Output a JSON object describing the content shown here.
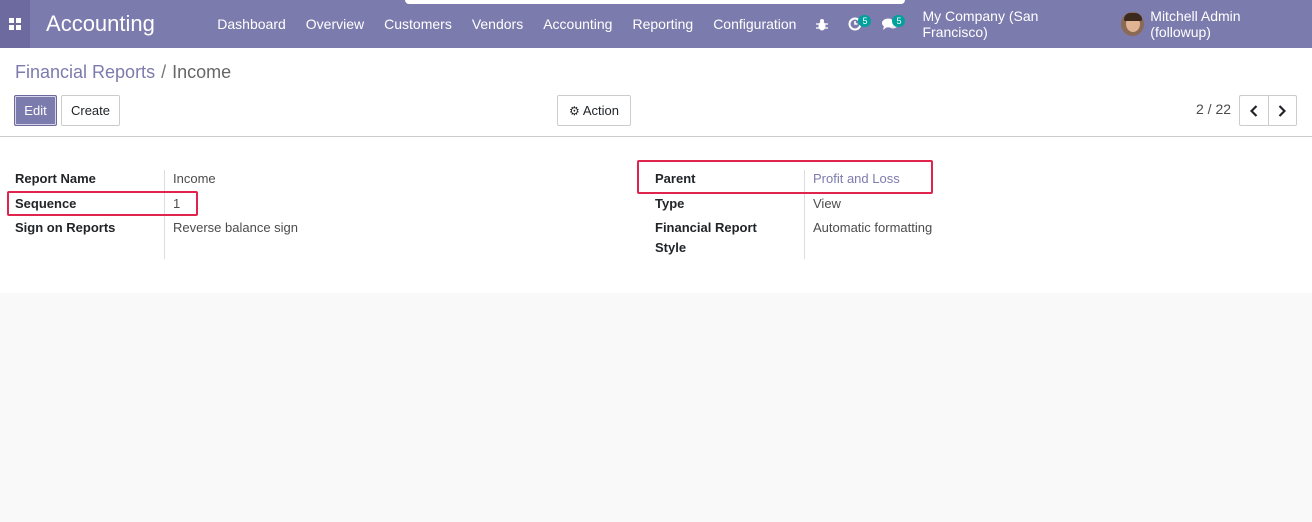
{
  "navbar": {
    "app_title": "Accounting",
    "menu": [
      "Dashboard",
      "Overview",
      "Customers",
      "Vendors",
      "Accounting",
      "Reporting",
      "Configuration"
    ],
    "activity_badge": "5",
    "messages_badge": "5",
    "company": "My Company (San Francisco)",
    "user": "Mitchell Admin (followup)",
    "brand_color": "#7c7bad"
  },
  "breadcrumb": {
    "parent": "Financial Reports",
    "separator": "/",
    "current": "Income"
  },
  "toolbar": {
    "edit_label": "Edit",
    "create_label": "Create",
    "action_label": "Action"
  },
  "pager": {
    "value": "2 / 22"
  },
  "form": {
    "left": [
      {
        "label": "Report Name",
        "value": "Income"
      },
      {
        "label": "Sequence",
        "value": "1"
      },
      {
        "label": "Sign on Reports",
        "value": "Reverse balance sign"
      }
    ],
    "right": [
      {
        "label": "Parent",
        "value": "Profit and Loss"
      },
      {
        "label": "Type",
        "value": "View"
      },
      {
        "label": "Financial Report",
        "label2": "Style",
        "value": "Automatic formatting"
      }
    ]
  },
  "highlight_color": "#e0244e"
}
